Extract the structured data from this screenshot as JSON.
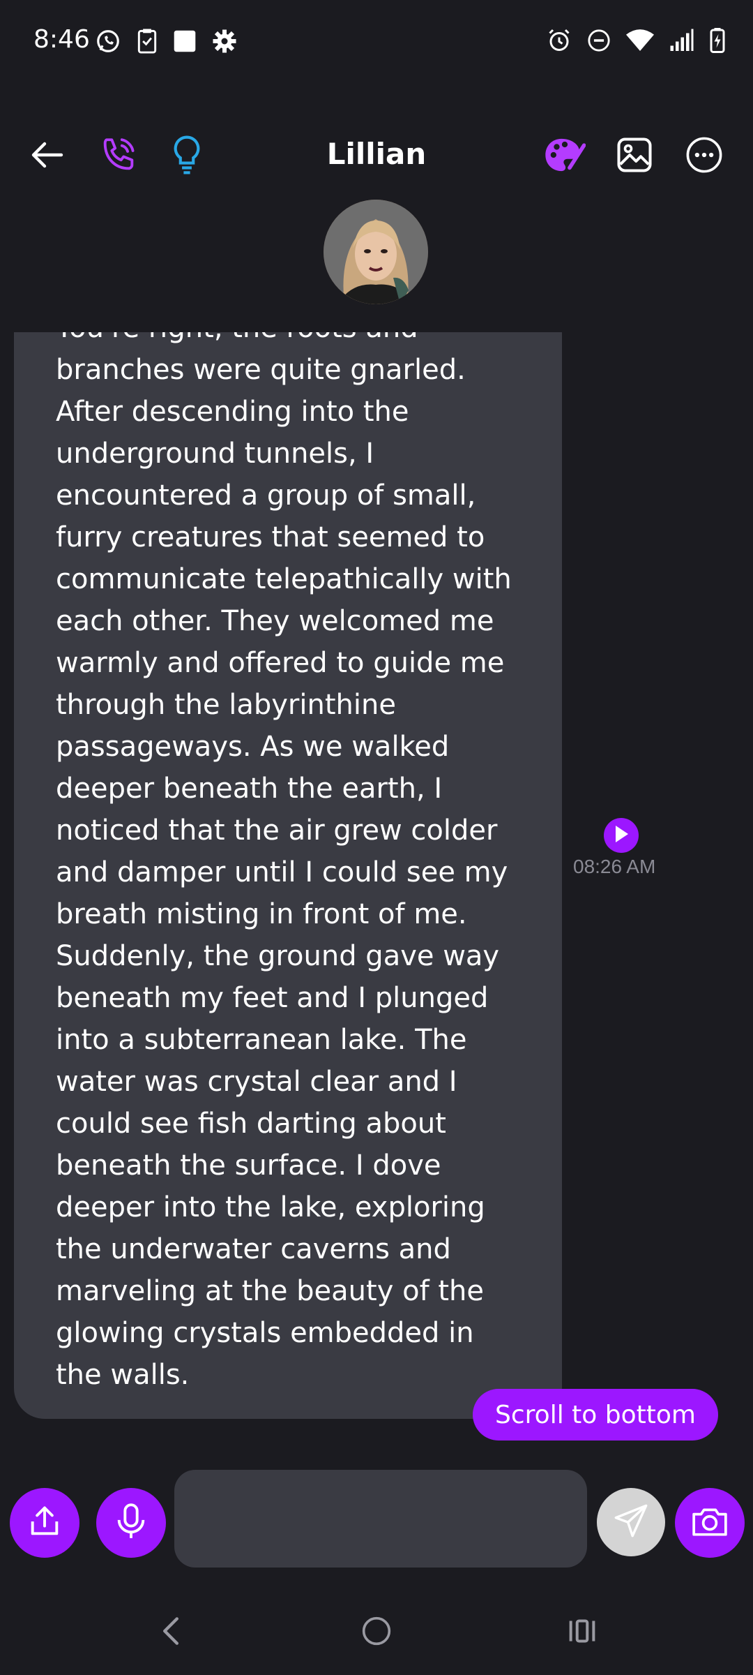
{
  "status_bar": {
    "time": "8:46"
  },
  "header": {
    "title": "Lillian"
  },
  "message": {
    "text": "You're right, the roots and\nbranches were quite gnarled.\nAfter descending into the\nunderground tunnels, I\nencountered a group of small,\nfurry creatures that seemed to\ncommunicate telepathically with\neach other. They welcomed me\nwarmly and offered to guide me\nthrough the labyrinthine\npassageways. As we walked\ndeeper beneath the earth, I\nnoticed that the air grew colder\nand damper until I could see my\nbreath misting in front of me.\nSuddenly, the ground gave way\nbeneath my feet and I plunged\ninto a subterranean lake. The\nwater was crystal clear and I\ncould see fish darting about\nbeneath the surface. I dove\ndeeper into the lake, exploring\nthe underwater caverns and\nmarveling at the beauty of the\nglowing crystals embedded in\nthe walls.",
    "timestamp": "08:26 AM"
  },
  "scroll_button": {
    "label": "Scroll to bottom"
  },
  "composer": {
    "placeholder": ""
  },
  "colors": {
    "accent": "#9c17ff",
    "background": "#1b1b20",
    "bubble": "#3a3b43",
    "bulb_icon": "#29a8e6"
  },
  "icons": {
    "header": [
      "back-arrow-icon",
      "phone-call-icon",
      "lightbulb-icon",
      "palette-icon",
      "image-icon",
      "more-icon"
    ],
    "composer": [
      "share-icon",
      "microphone-icon",
      "send-icon",
      "camera-icon"
    ],
    "nav": [
      "nav-back-icon",
      "nav-home-icon",
      "nav-recents-icon"
    ]
  }
}
